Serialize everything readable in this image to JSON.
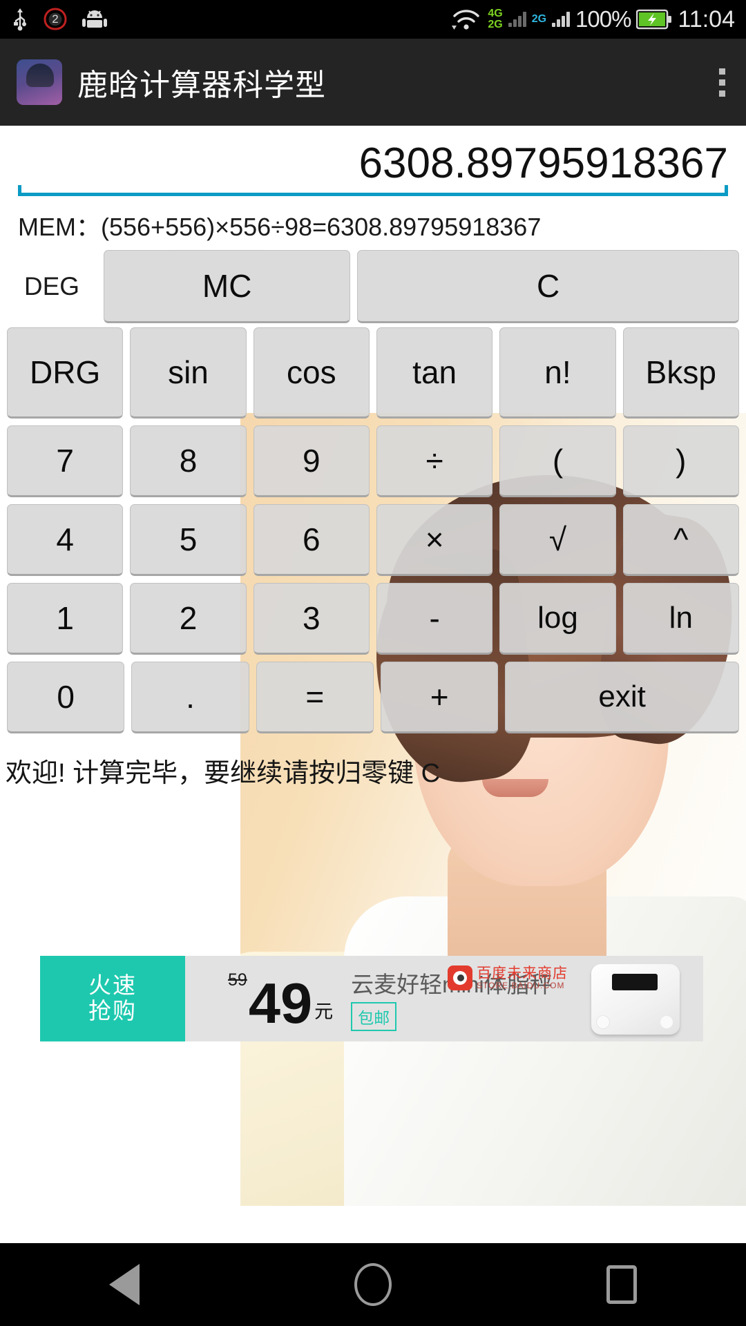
{
  "status_bar": {
    "icons_left": [
      "usb-icon",
      "alarm-icon",
      "android-icon"
    ],
    "alarm_count": "2",
    "network_4g": "4G",
    "network_2g_primary": "2G",
    "network_2g_secondary": "2G",
    "battery_percent": "100%",
    "clock": "11:04"
  },
  "action_bar": {
    "title": "鹿晗计算器科学型",
    "overflow_label": "⋮"
  },
  "calculator": {
    "display_value": "6308.89795918367",
    "memory_line": "MEM：(556+556)×556÷98=6308.89795918367",
    "angle_mode": "DEG",
    "top_buttons": [
      {
        "label": "MC",
        "name": "memory-clear-button"
      },
      {
        "label": "C",
        "name": "clear-button"
      }
    ],
    "rows": [
      {
        "tall": true,
        "keys": [
          {
            "label": "DRG",
            "name": "drg-button"
          },
          {
            "label": "sin",
            "name": "sin-button"
          },
          {
            "label": "cos",
            "name": "cos-button"
          },
          {
            "label": "tan",
            "name": "tan-button"
          },
          {
            "label": "n!",
            "name": "factorial-button"
          },
          {
            "label": "Bksp",
            "name": "backspace-button"
          }
        ]
      },
      {
        "tall": false,
        "keys": [
          {
            "label": "7",
            "name": "digit-7-button"
          },
          {
            "label": "8",
            "name": "digit-8-button"
          },
          {
            "label": "9",
            "name": "digit-9-button"
          },
          {
            "label": "÷",
            "name": "divide-button"
          },
          {
            "label": "(",
            "name": "left-paren-button"
          },
          {
            "label": ")",
            "name": "right-paren-button"
          }
        ]
      },
      {
        "tall": false,
        "keys": [
          {
            "label": "4",
            "name": "digit-4-button"
          },
          {
            "label": "5",
            "name": "digit-5-button"
          },
          {
            "label": "6",
            "name": "digit-6-button"
          },
          {
            "label": "×",
            "name": "multiply-button"
          },
          {
            "label": "√",
            "name": "sqrt-button"
          },
          {
            "label": "^",
            "name": "power-button"
          }
        ]
      },
      {
        "tall": false,
        "keys": [
          {
            "label": "1",
            "name": "digit-1-button"
          },
          {
            "label": "2",
            "name": "digit-2-button"
          },
          {
            "label": "3",
            "name": "digit-3-button"
          },
          {
            "label": "-",
            "name": "minus-button"
          },
          {
            "label": "log",
            "name": "log-button"
          },
          {
            "label": "ln",
            "name": "ln-button"
          }
        ]
      },
      {
        "tall": false,
        "keys": [
          {
            "label": "0",
            "name": "digit-0-button"
          },
          {
            "label": ".",
            "name": "decimal-point-button"
          },
          {
            "label": "=",
            "name": "equals-button"
          },
          {
            "label": "+",
            "name": "plus-button"
          },
          {
            "label": "exit",
            "name": "exit-button",
            "span": 2
          }
        ]
      }
    ],
    "status_text": "欢迎!    计算完毕，要继续请按归零键 C"
  },
  "ad": {
    "badge_line1": "火速",
    "badge_line2": "抢购",
    "old_price": "59",
    "new_price": "49",
    "currency": "元",
    "free_shipping": "包邮",
    "product_title": "云麦好轻mini体脂秤",
    "brand_cn": "百度未来商店",
    "brand_en": "STORE.BAIDU.COM"
  },
  "nav_bar": {
    "back": "back-icon",
    "home": "home-icon",
    "recents": "recents-icon"
  },
  "colors": {
    "accent_underline": "#0b9bc4",
    "ad_accent": "#1ec8ae",
    "action_bar_bg": "#242424",
    "button_bg": "#d8d8d8"
  }
}
